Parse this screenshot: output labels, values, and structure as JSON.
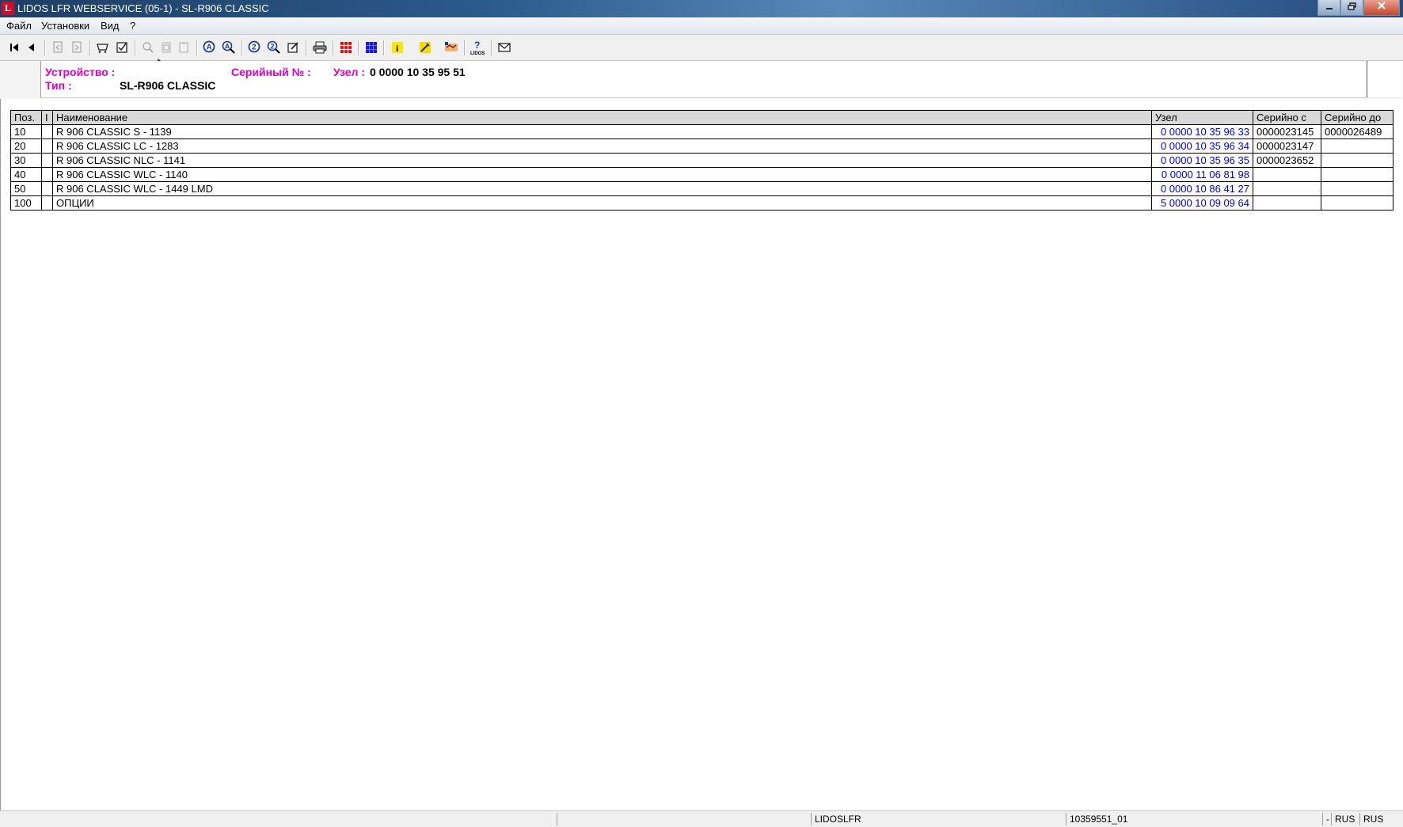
{
  "window": {
    "title": "LIDOS LFR WEBSERVICE (05-1) - SL-R906 CLASSIC",
    "icon_letter": "L"
  },
  "menu": [
    "Файл",
    "Установки",
    "Вид",
    "?"
  ],
  "header": {
    "device_label": "Устройство :",
    "type_label": "Тип :",
    "type_value": "SL-R906 CLASSIC",
    "serial_label": "Серийный № :",
    "node_label": "Узел :",
    "node_value": "0 0000 10 35 95 51"
  },
  "table": {
    "columns": [
      "Поз.",
      "I",
      "Наименование",
      "Узел",
      "Серийно с",
      "Серийно до"
    ],
    "rows": [
      {
        "pos": "10",
        "i": "",
        "name": "R 906 CLASSIC S - 1139",
        "node": "0 0000 10 35 96 33",
        "serial_from": "0000023145",
        "serial_to": "0000026489"
      },
      {
        "pos": "20",
        "i": "",
        "name": "R 906 CLASSIC LC - 1283",
        "node": "0 0000 10 35 96 34",
        "serial_from": "0000023147",
        "serial_to": ""
      },
      {
        "pos": "30",
        "i": "",
        "name": "R 906 CLASSIC NLC - 1141",
        "node": "0 0000 10 35 96 35",
        "serial_from": "0000023652",
        "serial_to": ""
      },
      {
        "pos": "40",
        "i": "",
        "name": "R 906 CLASSIC WLC - 1140",
        "node": "0 0000 11 06 81 98",
        "serial_from": "",
        "serial_to": ""
      },
      {
        "pos": "50",
        "i": "",
        "name": "R 906 CLASSIC WLC - 1449 LMD",
        "node": "0 0000 10 86 41 27",
        "serial_from": "",
        "serial_to": ""
      },
      {
        "pos": "100",
        "i": "",
        "name": "ОПЦИИ",
        "node": "5 0000 10 09 09 64",
        "serial_from": "",
        "serial_to": ""
      }
    ]
  },
  "status": {
    "app": "LIDOSLFR",
    "code": "10359551_01",
    "dash": "-",
    "lang1": "RUS",
    "lang2": "RUS"
  },
  "colors": {
    "label_magenta": "#e000c8",
    "link_blue": "#0000ee",
    "titlebar": "#2b5a8c"
  }
}
